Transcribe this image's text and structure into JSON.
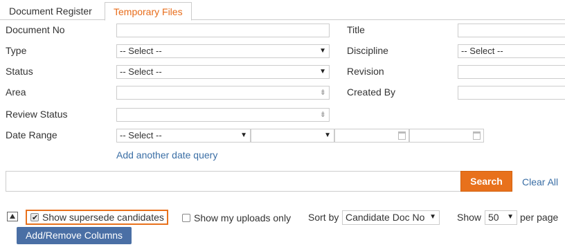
{
  "tabs": [
    {
      "label": "Document Register",
      "active": false
    },
    {
      "label": "Temporary Files",
      "active": true
    }
  ],
  "form": {
    "document_no": {
      "label": "Document No",
      "value": ""
    },
    "type": {
      "label": "Type",
      "value": "-- Select --"
    },
    "status": {
      "label": "Status",
      "value": "-- Select --"
    },
    "area": {
      "label": "Area",
      "value": ""
    },
    "review_status": {
      "label": "Review Status",
      "value": ""
    },
    "date_range": {
      "label": "Date Range",
      "value": "-- Select --",
      "secondary_value": "",
      "from_value": "",
      "to_value": ""
    },
    "add_date_query": "Add another date query",
    "title": {
      "label": "Title",
      "value": ""
    },
    "discipline": {
      "label": "Discipline",
      "value": "-- Select --"
    },
    "revision": {
      "label": "Revision",
      "value": ""
    },
    "created_by": {
      "label": "Created By",
      "value": ""
    }
  },
  "search": {
    "value": "",
    "button_label": "Search",
    "clear_label": "Clear All"
  },
  "toolbar": {
    "show_supersede_candidates": {
      "label": "Show supersede candidates",
      "checked": true
    },
    "show_my_uploads_only": {
      "label": "Show my uploads only",
      "checked": false
    },
    "sort_by_label": "Sort by",
    "sort_by_value": "Candidate Doc No",
    "show_label": "Show",
    "per_page_value": "50",
    "per_page_label": "per page",
    "add_remove_columns": "Add/Remove Columns"
  },
  "colors": {
    "accent": "#e8711c",
    "link": "#3a6ea5",
    "columns_button": "#4a6fa5"
  },
  "icons": [
    "dropdown-arrow-icon",
    "multi-select-icon",
    "calendar-icon",
    "collapse-up-icon",
    "checkmark-icon"
  ]
}
